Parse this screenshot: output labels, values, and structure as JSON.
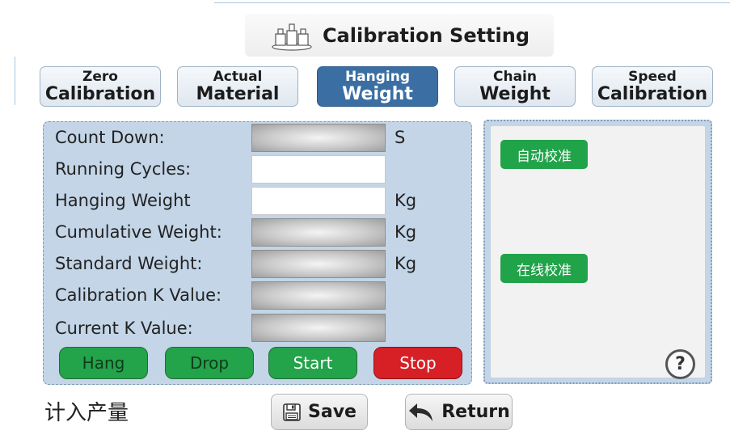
{
  "title": "Calibration Setting",
  "tabs": [
    {
      "line1": "Zero",
      "line2": "Calibration"
    },
    {
      "line1": "Actual",
      "line2": "Material"
    },
    {
      "line1": "Hanging",
      "line2": "Weight",
      "active": true
    },
    {
      "line1": "Chain",
      "line2": "Weight"
    },
    {
      "line1": "Speed",
      "line2": "Calibration"
    }
  ],
  "rows": [
    {
      "label": "Count Down:",
      "unit": "S",
      "type": "display"
    },
    {
      "label": "Running Cycles:",
      "unit": "",
      "type": "input"
    },
    {
      "label": "Hanging Weight",
      "unit": "Kg",
      "type": "input"
    },
    {
      "label": "Cumulative Weight:",
      "unit": "Kg",
      "type": "display"
    },
    {
      "label": "Standard Weight:",
      "unit": "Kg",
      "type": "display"
    },
    {
      "label": "Calibration K Value:",
      "unit": "",
      "type": "display"
    },
    {
      "label": "Current K Value:",
      "unit": "",
      "type": "display"
    }
  ],
  "actions": {
    "hang": "Hang",
    "drop": "Drop",
    "start": "Start",
    "stop": "Stop"
  },
  "right_panel": {
    "auto_calibrate": "自动校准",
    "online_calibrate": "在线校准",
    "help": "?"
  },
  "bottom": {
    "count_output_label": "计入产量",
    "save": "Save",
    "return": "Return"
  },
  "colors": {
    "panel": "#c3d5e7",
    "active_tab": "#3b6fa3",
    "green": "#23a34a",
    "red": "#d71f26"
  }
}
